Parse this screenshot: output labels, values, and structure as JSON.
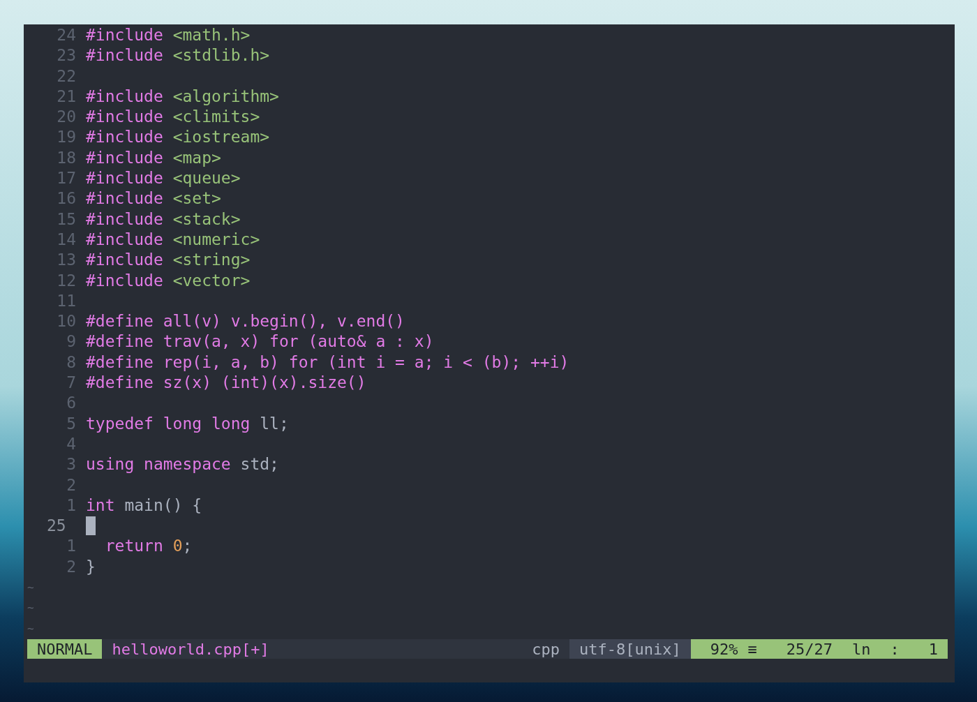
{
  "editor": {
    "lines": [
      {
        "number": "24",
        "current": false,
        "tokens": [
          {
            "kind": "keyword",
            "text": "#include "
          },
          {
            "kind": "header",
            "text": "<math.h>"
          }
        ]
      },
      {
        "number": "23",
        "current": false,
        "tokens": [
          {
            "kind": "keyword",
            "text": "#include "
          },
          {
            "kind": "header",
            "text": "<stdlib.h>"
          }
        ]
      },
      {
        "number": "22",
        "current": false
      },
      {
        "number": "21",
        "current": false,
        "tokens": [
          {
            "kind": "keyword",
            "text": "#include "
          },
          {
            "kind": "header",
            "text": "<algorithm>"
          }
        ]
      },
      {
        "number": "20",
        "current": false,
        "tokens": [
          {
            "kind": "keyword",
            "text": "#include "
          },
          {
            "kind": "header",
            "text": "<climits>"
          }
        ]
      },
      {
        "number": "19",
        "current": false,
        "tokens": [
          {
            "kind": "keyword",
            "text": "#include "
          },
          {
            "kind": "header",
            "text": "<iostream>"
          }
        ]
      },
      {
        "number": "18",
        "current": false,
        "tokens": [
          {
            "kind": "keyword",
            "text": "#include "
          },
          {
            "kind": "header",
            "text": "<map>"
          }
        ]
      },
      {
        "number": "17",
        "current": false,
        "tokens": [
          {
            "kind": "keyword",
            "text": "#include "
          },
          {
            "kind": "header",
            "text": "<queue>"
          }
        ]
      },
      {
        "number": "16",
        "current": false,
        "tokens": [
          {
            "kind": "keyword",
            "text": "#include "
          },
          {
            "kind": "header",
            "text": "<set>"
          }
        ]
      },
      {
        "number": "15",
        "current": false,
        "tokens": [
          {
            "kind": "keyword",
            "text": "#include "
          },
          {
            "kind": "header",
            "text": "<stack>"
          }
        ]
      },
      {
        "number": "14",
        "current": false,
        "tokens": [
          {
            "kind": "keyword",
            "text": "#include "
          },
          {
            "kind": "header",
            "text": "<numeric>"
          }
        ]
      },
      {
        "number": "13",
        "current": false,
        "tokens": [
          {
            "kind": "keyword",
            "text": "#include "
          },
          {
            "kind": "header",
            "text": "<string>"
          }
        ]
      },
      {
        "number": "12",
        "current": false,
        "tokens": [
          {
            "kind": "keyword",
            "text": "#include "
          },
          {
            "kind": "header",
            "text": "<vector>"
          }
        ]
      },
      {
        "number": "11",
        "current": false
      },
      {
        "number": "10",
        "current": false,
        "tokens": [
          {
            "kind": "keyword",
            "text": "#define all(v) v.begin(), v.end()"
          }
        ]
      },
      {
        "number": "9",
        "current": false,
        "tokens": [
          {
            "kind": "keyword",
            "text": "#define trav(a, x) for (auto& a : x)"
          }
        ]
      },
      {
        "number": "8",
        "current": false,
        "tokens": [
          {
            "kind": "keyword",
            "text": "#define rep(i, a, b) for (int i = a; i < (b); ++i)"
          }
        ]
      },
      {
        "number": "7",
        "current": false,
        "tokens": [
          {
            "kind": "keyword",
            "text": "#define sz(x) (int)(x).size()"
          }
        ]
      },
      {
        "number": "6",
        "current": false
      },
      {
        "number": "5",
        "current": false,
        "tokens": [
          {
            "kind": "keyword",
            "text": "typedef long long "
          },
          {
            "kind": "plain",
            "text": "ll;"
          }
        ]
      },
      {
        "number": "4",
        "current": false
      },
      {
        "number": "3",
        "current": false,
        "tokens": [
          {
            "kind": "keyword",
            "text": "using namespace "
          },
          {
            "kind": "plain",
            "text": "std;"
          }
        ]
      },
      {
        "number": "2",
        "current": false
      },
      {
        "number": "1",
        "current": false,
        "tokens": [
          {
            "kind": "keyword",
            "text": "int "
          },
          {
            "kind": "plain",
            "text": "main() {"
          }
        ]
      },
      {
        "number": "25",
        "current": true
      },
      {
        "number": "1",
        "current": false,
        "tokens": [
          {
            "kind": "keyword",
            "text": "  return "
          },
          {
            "kind": "number",
            "text": "0"
          },
          {
            "kind": "plain",
            "text": ";"
          }
        ]
      },
      {
        "number": "2",
        "current": false,
        "tokens": [
          {
            "kind": "plain",
            "text": "}"
          }
        ]
      }
    ],
    "filler": [
      "~",
      "~",
      "~"
    ]
  },
  "status_bar": {
    "mode": "NORMAL",
    "file": "helloworld.cpp[+]",
    "filetype": "cpp",
    "encoding": "utf-8[unix]",
    "percent": "92%",
    "lines_glyph": "≡",
    "position": "25/27",
    "ln_glyph": "ln",
    "separator": ":",
    "column": "1"
  }
}
